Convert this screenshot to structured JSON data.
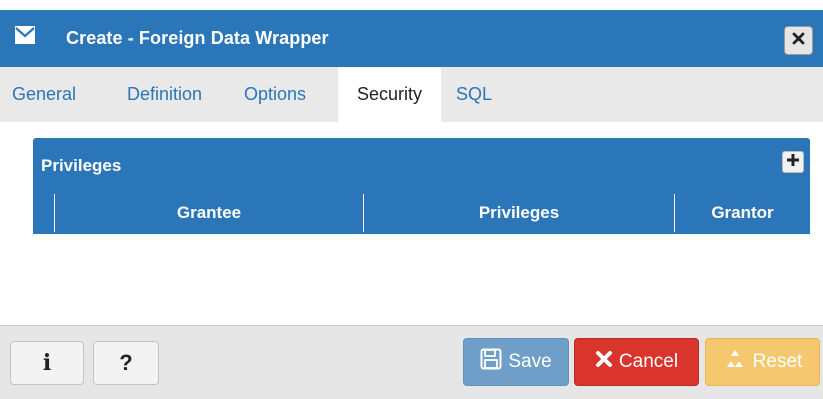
{
  "dialog": {
    "title": "Create - Foreign Data Wrapper",
    "title_icon": "envelope-icon",
    "close_icon": "close-icon"
  },
  "tabs": [
    {
      "label": "General",
      "active": false
    },
    {
      "label": "Definition",
      "active": false
    },
    {
      "label": "Options",
      "active": false
    },
    {
      "label": "Security",
      "active": true
    },
    {
      "label": "SQL",
      "active": false
    }
  ],
  "privileges": {
    "title": "Privileges",
    "add_icon": "plus-icon",
    "columns": [
      "Grantee",
      "Privileges",
      "Grantor"
    ],
    "rows": []
  },
  "footer": {
    "info_label": "i",
    "help_label": "?",
    "save_label": "Save",
    "cancel_label": "Cancel",
    "reset_label": "Reset"
  },
  "colors": {
    "primary": "#2b76b9",
    "save": "#6f9ec8",
    "cancel": "#d9352c",
    "reset": "#f5c870"
  }
}
